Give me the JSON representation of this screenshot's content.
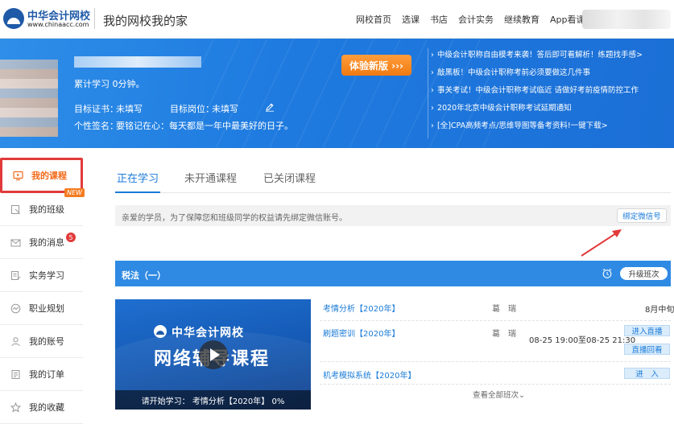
{
  "header": {
    "logo_name": "中华会计网校",
    "logo_url": "www.chinaacc.com",
    "slogan": "我的网校我的家",
    "nav": [
      "网校首页",
      "选课",
      "书店",
      "会计实务",
      "继续教育",
      "App看课"
    ]
  },
  "profile": {
    "study_time": "累计学习 0分钟。",
    "cert_label": "目标证书：",
    "cert_value": "未填写",
    "position_label": "目标岗位：",
    "position_value": "未填写",
    "signature_label": "个性签名：",
    "signature_value": "要铭记在心：每天都是一年中最美好的日子。",
    "trial_button": "体验新版 ›››"
  },
  "news": [
    "中级会计职称自由模考来袭！答后即可看解析！练题找手感>",
    "敲黑板！中级会计职称考前必须要做这几件事",
    "事关考试！中级会计职称考试临近 请做好考前疫情防控工作",
    "2020年北京中级会计职称考试延期通知",
    "[全]CPA高频考点/思维导图等备考资料!一键下载>"
  ],
  "sidebar": {
    "items": [
      {
        "label": "我的课程",
        "icon": "monitor-icon"
      },
      {
        "label": "我的班级",
        "icon": "class-icon",
        "badge": "NEW"
      },
      {
        "label": "我的消息",
        "icon": "mail-icon",
        "count": "5"
      },
      {
        "label": "实务学习",
        "icon": "document-edit-icon"
      },
      {
        "label": "职业规划",
        "icon": "chart-icon"
      },
      {
        "label": "我的账号",
        "icon": "user-icon"
      },
      {
        "label": "我的订单",
        "icon": "order-icon"
      },
      {
        "label": "我的收藏",
        "icon": "star-icon"
      }
    ]
  },
  "tabs": [
    "正在学习",
    "未开通课程",
    "已关闭课程"
  ],
  "notice": {
    "text": "亲爱的学员，为了保障您和班级同学的权益请先绑定微信账号。",
    "bind_button": "绑定微信号"
  },
  "course": {
    "title": "税法（一）",
    "upgrade_button": "升级班次",
    "video_brand": "中华会计网校",
    "video_title": "网络辅导课程",
    "video_caption": "请开始学习：  考情分析【2020年】 0%",
    "lessons": [
      {
        "name": "考情分析【2020年】",
        "teacher": "葛　瑞",
        "time": "8月中旬"
      },
      {
        "name": "刷题密训【2020年】",
        "teacher": "葛　瑞",
        "time": "08-25 19:00至08-25 21:30",
        "btn1": "进入直播",
        "btn2": "直播回看"
      },
      {
        "name": "机考模拟系统【2020年】",
        "teacher": "",
        "time": "",
        "btn1": "进　入"
      }
    ],
    "more": "查看全部班次⌄"
  },
  "colors": {
    "brand_blue": "#1b7bd8",
    "orange": "#f26a1b",
    "highlight_red": "#e23a3a"
  }
}
